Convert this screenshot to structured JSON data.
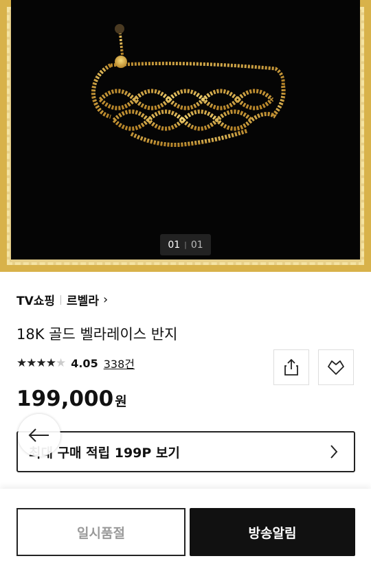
{
  "gallery": {
    "current": "01",
    "total": "01"
  },
  "product": {
    "channel": "TV쇼핑",
    "brand": "르벨라",
    "name": "18K 골드 벨라레이스 반지",
    "rating": {
      "score": "4.05",
      "count": "338건",
      "stars": 4.05
    },
    "price": "199,000",
    "currency": "원"
  },
  "points": {
    "label": "최대 구매 적립 199P 보기"
  },
  "actions": {
    "soldout": "일시품절",
    "alert": "방송알림"
  },
  "colors": {
    "frame_gold": "#d8b24a",
    "chain_gold": "#e0b84a",
    "dark": "#111111"
  }
}
